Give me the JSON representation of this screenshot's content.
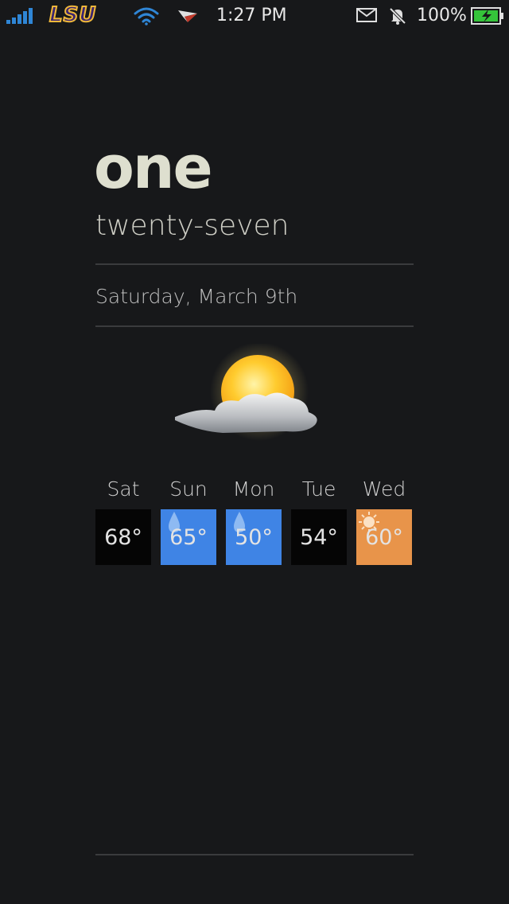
{
  "status_bar": {
    "carrier": "LSU",
    "time": "1:27 PM",
    "battery_percent": "100%",
    "battery_level": 1.0,
    "icons": [
      "signal-icon",
      "wifi-icon",
      "navigation-icon",
      "mail-icon",
      "bell-muted-icon",
      "battery-charging-icon"
    ]
  },
  "clock": {
    "hour": "one",
    "minutes": "twenty-seven"
  },
  "date": "Saturday, March 9th",
  "weather": {
    "current_icon": "partly-cloudy-icon"
  },
  "forecast": [
    {
      "day": "Sat",
      "temp": "68°",
      "color": "#050505",
      "icon": ""
    },
    {
      "day": "Sun",
      "temp": "65°",
      "color": "#3f84e5",
      "icon": "rain-drop-icon"
    },
    {
      "day": "Mon",
      "temp": "50°",
      "color": "#3f84e5",
      "icon": "rain-drop-icon"
    },
    {
      "day": "Tue",
      "temp": "54°",
      "color": "#050505",
      "icon": ""
    },
    {
      "day": "Wed",
      "temp": "60°",
      "color": "#e8944a",
      "icon": "sun-icon"
    }
  ],
  "colors": {
    "background": "#17181a",
    "rain": "#3f84e5",
    "sunny": "#e8944a"
  }
}
